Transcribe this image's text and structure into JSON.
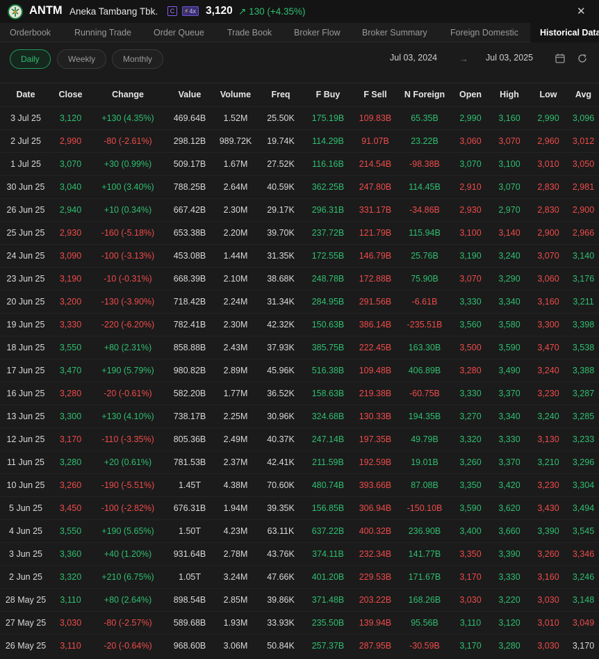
{
  "header": {
    "ticker": "ANTM",
    "company": "Aneka Tambang Tbk.",
    "badge_c": "C",
    "badge_x": "4x",
    "price": "3,120",
    "change": "130 (+4.35%)",
    "close_glyph": "✕"
  },
  "tabs": [
    "Orderbook",
    "Running Trade",
    "Order Queue",
    "Trade Book",
    "Broker Flow",
    "Broker Summary",
    "Foreign Domestic",
    "Historical Data"
  ],
  "filters": {
    "periods": [
      "Daily",
      "Weekly",
      "Monthly"
    ],
    "active_period": "Daily",
    "date_from": "Jul 03, 2024",
    "date_to": "Jul 03, 2025",
    "arrow": "→"
  },
  "colors": {
    "up": "#2fbf71",
    "down": "#ef4b4b",
    "neutral": "#d9d9d9",
    "accent": "#1d9a5c"
  },
  "table": {
    "columns": [
      "Date",
      "Close",
      "Change",
      "Value",
      "Volume",
      "Freq",
      "F Buy",
      "F Sell",
      "N Foreign",
      "Open",
      "High",
      "Low",
      "Avg"
    ],
    "rows": [
      [
        "3 Jul 25",
        "3,120",
        "+130 (4.35%)",
        "469.64B",
        "1.52M",
        "25.50K",
        "175.19B",
        "109.83B",
        "65.35B",
        "2,990",
        "3,160",
        "2,990",
        "3,096"
      ],
      [
        "2 Jul 25",
        "2,990",
        "-80 (-2.61%)",
        "298.12B",
        "989.72K",
        "19.74K",
        "114.29B",
        "91.07B",
        "23.22B",
        "3,060",
        "3,070",
        "2,960",
        "3,012"
      ],
      [
        "1 Jul 25",
        "3,070",
        "+30 (0.99%)",
        "509.17B",
        "1.67M",
        "27.52K",
        "116.16B",
        "214.54B",
        "-98.38B",
        "3,070",
        "3,100",
        "3,010",
        "3,050"
      ],
      [
        "30 Jun 25",
        "3,040",
        "+100 (3.40%)",
        "788.25B",
        "2.64M",
        "40.59K",
        "362.25B",
        "247.80B",
        "114.45B",
        "2,910",
        "3,070",
        "2,830",
        "2,981"
      ],
      [
        "26 Jun 25",
        "2,940",
        "+10 (0.34%)",
        "667.42B",
        "2.30M",
        "29.17K",
        "296.31B",
        "331.17B",
        "-34.86B",
        "2,930",
        "2,970",
        "2,830",
        "2,900"
      ],
      [
        "25 Jun 25",
        "2,930",
        "-160 (-5.18%)",
        "653.38B",
        "2.20M",
        "39.70K",
        "237.72B",
        "121.79B",
        "115.94B",
        "3,100",
        "3,140",
        "2,900",
        "2,966"
      ],
      [
        "24 Jun 25",
        "3,090",
        "-100 (-3.13%)",
        "453.08B",
        "1.44M",
        "31.35K",
        "172.55B",
        "146.79B",
        "25.76B",
        "3,190",
        "3,240",
        "3,070",
        "3,140"
      ],
      [
        "23 Jun 25",
        "3,190",
        "-10 (-0.31%)",
        "668.39B",
        "2.10M",
        "38.68K",
        "248.78B",
        "172.88B",
        "75.90B",
        "3,070",
        "3,290",
        "3,060",
        "3,176"
      ],
      [
        "20 Jun 25",
        "3,200",
        "-130 (-3.90%)",
        "718.42B",
        "2.24M",
        "31.34K",
        "284.95B",
        "291.56B",
        "-6.61B",
        "3,330",
        "3,340",
        "3,160",
        "3,211"
      ],
      [
        "19 Jun 25",
        "3,330",
        "-220 (-6.20%)",
        "782.41B",
        "2.30M",
        "42.32K",
        "150.63B",
        "386.14B",
        "-235.51B",
        "3,560",
        "3,580",
        "3,300",
        "3,398"
      ],
      [
        "18 Jun 25",
        "3,550",
        "+80 (2.31%)",
        "858.88B",
        "2.43M",
        "37.93K",
        "385.75B",
        "222.45B",
        "163.30B",
        "3,500",
        "3,590",
        "3,470",
        "3,538"
      ],
      [
        "17 Jun 25",
        "3,470",
        "+190 (5.79%)",
        "980.82B",
        "2.89M",
        "45.96K",
        "516.38B",
        "109.48B",
        "406.89B",
        "3,280",
        "3,490",
        "3,240",
        "3,388"
      ],
      [
        "16 Jun 25",
        "3,280",
        "-20 (-0.61%)",
        "582.20B",
        "1.77M",
        "36.52K",
        "158.63B",
        "219.38B",
        "-60.75B",
        "3,330",
        "3,370",
        "3,230",
        "3,287"
      ],
      [
        "13 Jun 25",
        "3,300",
        "+130 (4.10%)",
        "738.17B",
        "2.25M",
        "30.96K",
        "324.68B",
        "130.33B",
        "194.35B",
        "3,270",
        "3,340",
        "3,240",
        "3,285"
      ],
      [
        "12 Jun 25",
        "3,170",
        "-110 (-3.35%)",
        "805.36B",
        "2.49M",
        "40.37K",
        "247.14B",
        "197.35B",
        "49.79B",
        "3,320",
        "3,330",
        "3,130",
        "3,233"
      ],
      [
        "11 Jun 25",
        "3,280",
        "+20 (0.61%)",
        "781.53B",
        "2.37M",
        "42.41K",
        "211.59B",
        "192.59B",
        "19.01B",
        "3,260",
        "3,370",
        "3,210",
        "3,296"
      ],
      [
        "10 Jun 25",
        "3,260",
        "-190 (-5.51%)",
        "1.45T",
        "4.38M",
        "70.60K",
        "480.74B",
        "393.66B",
        "87.08B",
        "3,350",
        "3,420",
        "3,230",
        "3,304"
      ],
      [
        "5 Jun 25",
        "3,450",
        "-100 (-2.82%)",
        "676.31B",
        "1.94M",
        "39.35K",
        "156.85B",
        "306.94B",
        "-150.10B",
        "3,590",
        "3,620",
        "3,430",
        "3,494"
      ],
      [
        "4 Jun 25",
        "3,550",
        "+190 (5.65%)",
        "1.50T",
        "4.23M",
        "63.11K",
        "637.22B",
        "400.32B",
        "236.90B",
        "3,400",
        "3,660",
        "3,390",
        "3,545"
      ],
      [
        "3 Jun 25",
        "3,360",
        "+40 (1.20%)",
        "931.64B",
        "2.78M",
        "43.76K",
        "374.11B",
        "232.34B",
        "141.77B",
        "3,350",
        "3,390",
        "3,260",
        "3,346"
      ],
      [
        "2 Jun 25",
        "3,320",
        "+210 (6.75%)",
        "1.05T",
        "3.24M",
        "47.66K",
        "401.20B",
        "229.53B",
        "171.67B",
        "3,170",
        "3,330",
        "3,160",
        "3,246"
      ],
      [
        "28 May 25",
        "3,110",
        "+80 (2.64%)",
        "898.54B",
        "2.85M",
        "39.86K",
        "371.48B",
        "203.22B",
        "168.26B",
        "3,030",
        "3,220",
        "3,030",
        "3,148"
      ],
      [
        "27 May 25",
        "3,030",
        "-80 (-2.57%)",
        "589.68B",
        "1.93M",
        "33.93K",
        "235.50B",
        "139.94B",
        "95.56B",
        "3,110",
        "3,120",
        "3,010",
        "3,049"
      ],
      [
        "26 May 25",
        "3,110",
        "-20 (-0.64%)",
        "968.60B",
        "3.06M",
        "50.84K",
        "257.37B",
        "287.95B",
        "-30.59B",
        "3,170",
        "3,280",
        "3,030",
        "3,170"
      ]
    ],
    "row_colors": [
      [
        "n",
        "u",
        "u",
        "n",
        "n",
        "n",
        "u",
        "d",
        "u",
        "u",
        "u",
        "u",
        "u"
      ],
      [
        "n",
        "d",
        "d",
        "n",
        "n",
        "n",
        "u",
        "d",
        "u",
        "d",
        "d",
        "d",
        "d"
      ],
      [
        "n",
        "u",
        "u",
        "n",
        "n",
        "n",
        "u",
        "d",
        "d",
        "u",
        "u",
        "d",
        "d"
      ],
      [
        "n",
        "u",
        "u",
        "n",
        "n",
        "n",
        "u",
        "d",
        "u",
        "d",
        "u",
        "d",
        "d"
      ],
      [
        "n",
        "u",
        "u",
        "n",
        "n",
        "n",
        "u",
        "d",
        "d",
        "d",
        "u",
        "d",
        "d"
      ],
      [
        "n",
        "d",
        "d",
        "n",
        "n",
        "n",
        "u",
        "d",
        "u",
        "d",
        "d",
        "d",
        "d"
      ],
      [
        "n",
        "d",
        "d",
        "n",
        "n",
        "n",
        "u",
        "d",
        "u",
        "u",
        "u",
        "d",
        "u"
      ],
      [
        "n",
        "d",
        "d",
        "n",
        "n",
        "n",
        "u",
        "d",
        "u",
        "d",
        "u",
        "d",
        "u"
      ],
      [
        "n",
        "d",
        "d",
        "n",
        "n",
        "n",
        "u",
        "d",
        "d",
        "u",
        "u",
        "d",
        "u"
      ],
      [
        "n",
        "d",
        "d",
        "n",
        "n",
        "n",
        "u",
        "d",
        "d",
        "u",
        "u",
        "d",
        "u"
      ],
      [
        "n",
        "u",
        "u",
        "n",
        "n",
        "n",
        "u",
        "d",
        "u",
        "d",
        "u",
        "d",
        "u"
      ],
      [
        "n",
        "u",
        "u",
        "n",
        "n",
        "n",
        "u",
        "d",
        "u",
        "d",
        "u",
        "d",
        "u"
      ],
      [
        "n",
        "d",
        "d",
        "n",
        "n",
        "n",
        "u",
        "d",
        "d",
        "u",
        "u",
        "d",
        "u"
      ],
      [
        "n",
        "u",
        "u",
        "n",
        "n",
        "n",
        "u",
        "d",
        "u",
        "u",
        "u",
        "u",
        "u"
      ],
      [
        "n",
        "d",
        "d",
        "n",
        "n",
        "n",
        "u",
        "d",
        "u",
        "u",
        "u",
        "d",
        "u"
      ],
      [
        "n",
        "u",
        "u",
        "n",
        "n",
        "n",
        "u",
        "d",
        "u",
        "u",
        "u",
        "u",
        "u"
      ],
      [
        "n",
        "d",
        "d",
        "n",
        "n",
        "n",
        "u",
        "d",
        "u",
        "u",
        "u",
        "d",
        "u"
      ],
      [
        "n",
        "d",
        "d",
        "n",
        "n",
        "n",
        "u",
        "d",
        "d",
        "u",
        "u",
        "d",
        "u"
      ],
      [
        "n",
        "u",
        "u",
        "n",
        "n",
        "n",
        "u",
        "d",
        "u",
        "u",
        "u",
        "u",
        "u"
      ],
      [
        "n",
        "u",
        "u",
        "n",
        "n",
        "n",
        "u",
        "d",
        "u",
        "d",
        "u",
        "d",
        "d"
      ],
      [
        "n",
        "u",
        "u",
        "n",
        "n",
        "n",
        "u",
        "d",
        "u",
        "d",
        "u",
        "d",
        "u"
      ],
      [
        "n",
        "u",
        "u",
        "n",
        "n",
        "n",
        "u",
        "d",
        "u",
        "d",
        "u",
        "d",
        "u"
      ],
      [
        "n",
        "d",
        "d",
        "n",
        "n",
        "n",
        "u",
        "d",
        "u",
        "u",
        "u",
        "d",
        "d"
      ],
      [
        "n",
        "d",
        "d",
        "n",
        "n",
        "n",
        "u",
        "d",
        "d",
        "u",
        "u",
        "d",
        "n"
      ]
    ]
  }
}
